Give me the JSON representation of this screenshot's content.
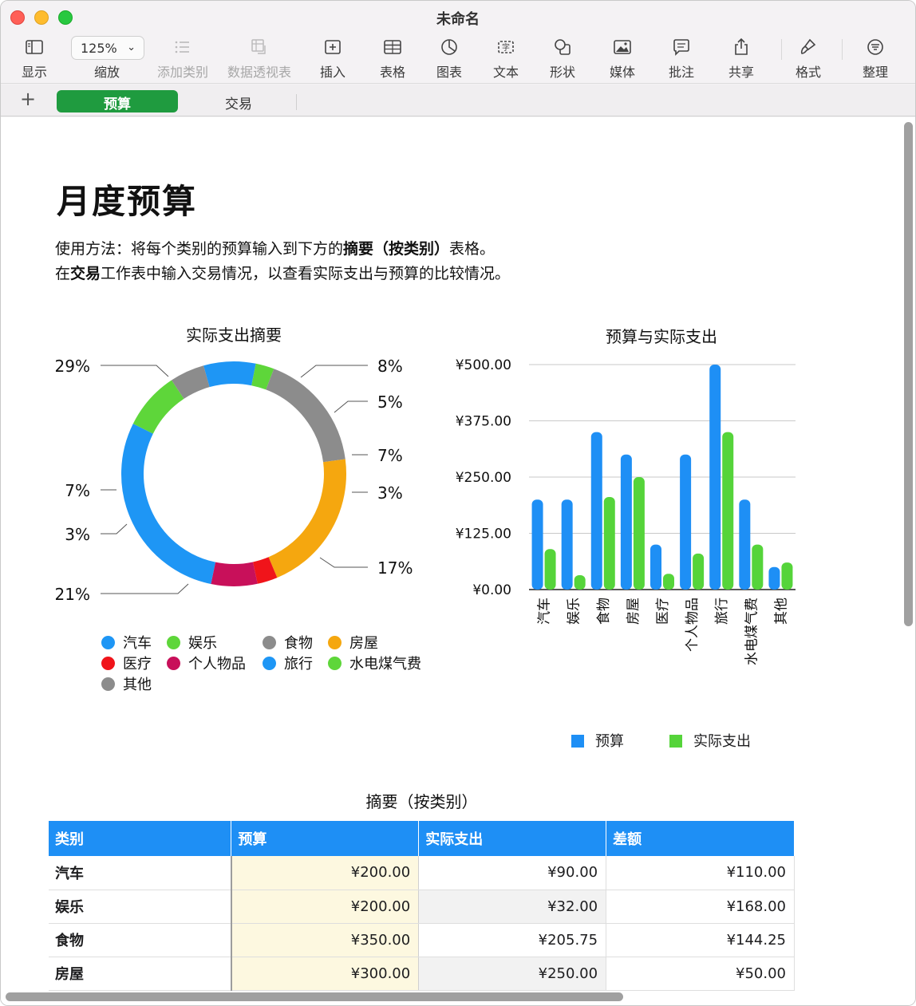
{
  "window": {
    "title": "未命名"
  },
  "toolbar": {
    "view_label": "显示",
    "zoom_value": "125%",
    "zoom_label": "缩放",
    "add_category_label": "添加类别",
    "pivot_label": "数据透视表",
    "insert_label": "插入",
    "table_label": "表格",
    "chart_label": "图表",
    "text_label": "文本",
    "shape_label": "形状",
    "media_label": "媒体",
    "comment_label": "批注",
    "share_label": "共享",
    "format_label": "格式",
    "organize_label": "整理"
  },
  "sheets": {
    "active": "预算",
    "other": "交易"
  },
  "document": {
    "title": "月度预算",
    "line1_a": "使用方法：将每个类别的预算输入到下方的",
    "line1_b": "摘要（按类别）",
    "line1_c": "表格。",
    "line2_a": "在",
    "line2_b": "交易",
    "line2_c": "工作表中输入交易情况，以查看实际支出与预算的比较情况。"
  },
  "chart_data": [
    {
      "type": "pie",
      "title": "实际支出摘要",
      "categories": [
        "汽车",
        "娱乐",
        "食物",
        "房屋",
        "医疗",
        "个人物品",
        "旅行",
        "水电煤气费",
        "其他"
      ],
      "values": [
        90,
        32,
        205.75,
        250,
        35,
        80,
        350,
        100,
        60
      ],
      "percent_labels": [
        "29%",
        "8%",
        "5%",
        "7%",
        "3%",
        "17%",
        "21%",
        "3%",
        "7%"
      ],
      "colors": [
        "#1e96f5",
        "#5ed63a",
        "#8c8c8c",
        "#f5a70f",
        "#f0141a",
        "#c8105a",
        "#1e96f5",
        "#5ed63a",
        "#8c8c8c"
      ],
      "legend_placement": "bottom"
    },
    {
      "type": "bar",
      "title": "预算与实际支出",
      "categories": [
        "汽车",
        "娱乐",
        "食物",
        "房屋",
        "医疗",
        "个人物品",
        "旅行",
        "水电煤气费",
        "其他"
      ],
      "series": [
        {
          "name": "预算",
          "color": "#1e8ff5",
          "values": [
            200,
            200,
            350,
            300,
            100,
            300,
            500,
            200,
            50
          ]
        },
        {
          "name": "实际支出",
          "color": "#55d43a",
          "values": [
            90,
            32,
            205.75,
            250,
            35,
            80,
            350,
            100,
            60
          ]
        }
      ],
      "y_ticks": [
        "¥500.00",
        "¥375.00",
        "¥250.00",
        "¥125.00",
        "¥0.00"
      ],
      "ylim": [
        0,
        500
      ],
      "grid": true,
      "legend_placement": "bottom"
    }
  ],
  "table": {
    "title": "摘要（按类别）",
    "headers": [
      "类别",
      "预算",
      "实际支出",
      "差额"
    ],
    "rows": [
      [
        "汽车",
        "¥200.00",
        "¥90.00",
        "¥110.00"
      ],
      [
        "娱乐",
        "¥200.00",
        "¥32.00",
        "¥168.00"
      ],
      [
        "食物",
        "¥350.00",
        "¥205.75",
        "¥144.25"
      ],
      [
        "房屋",
        "¥300.00",
        "¥250.00",
        "¥50.00"
      ]
    ]
  }
}
